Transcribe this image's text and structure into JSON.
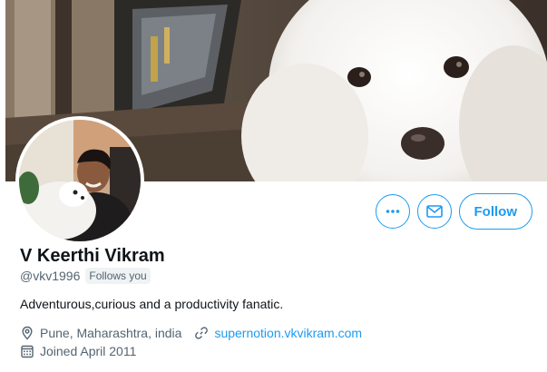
{
  "profile": {
    "display_name": "V Keerthi Vikram",
    "handle": "@vkv1996",
    "follows_you": "Follows you",
    "bio": "Adventurous,curious and a productivity fanatic.",
    "location": "Pune, Maharashtra, india",
    "website": "supernotion.vkvikram.com",
    "joined": "Joined April 2011"
  },
  "actions": {
    "follow_label": "Follow"
  },
  "icons": {
    "more": "more-options-icon",
    "message": "envelope-icon",
    "location": "location-pin-icon",
    "website": "link-icon",
    "joined": "calendar-icon"
  },
  "colors": {
    "accent": "#1d9bf0",
    "primary_text": "#0f1419",
    "secondary_text": "#536471",
    "badge_bg": "#eff3f4"
  }
}
